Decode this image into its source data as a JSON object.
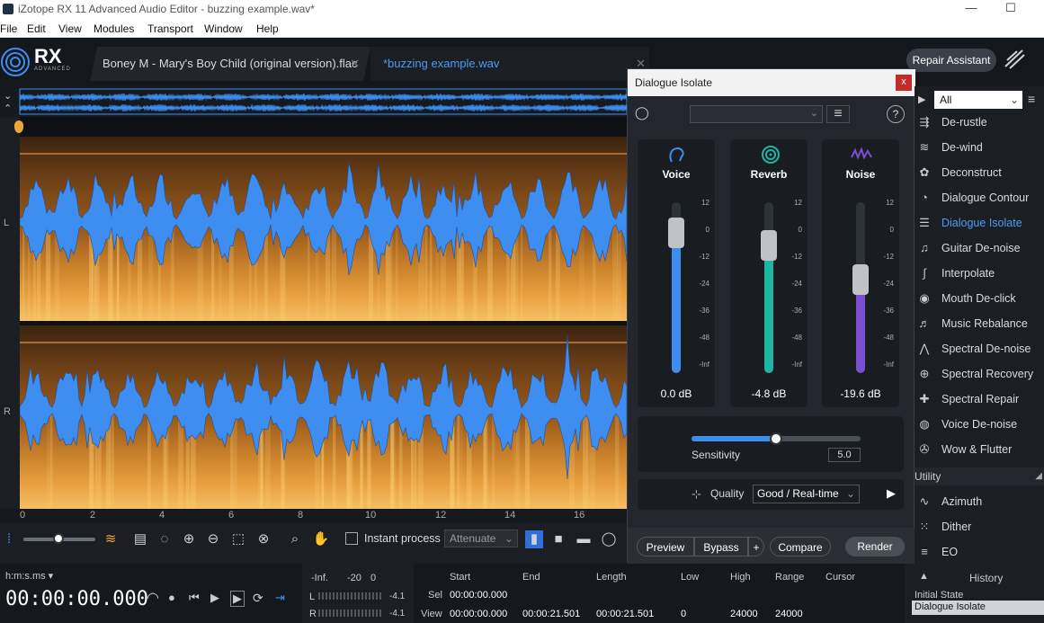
{
  "window": {
    "title": "iZotope RX 11 Advanced Audio Editor - buzzing example.wav*",
    "minimize": "—",
    "maximize": "☐"
  },
  "menu": [
    "File",
    "Edit",
    "View",
    "Modules",
    "Transport",
    "Window",
    "Help"
  ],
  "logo": {
    "rx": "RX",
    "advanced": "ADVANCED"
  },
  "tabs": [
    {
      "label": "Boney M - Mary's Boy Child (original version).flac",
      "close": "✕"
    },
    {
      "label": "*buzzing example.wav",
      "close": "✕"
    }
  ],
  "repair_assistant": "Repair Assistant",
  "channels": {
    "left": "L",
    "right": "R"
  },
  "ruler": [
    "0",
    "2",
    "4",
    "6",
    "8",
    "10",
    "12",
    "14",
    "16"
  ],
  "toolbar": {
    "instant_process": "Instant process",
    "attenuate": "Attenuate"
  },
  "transport": {
    "time_format": "h:m:s.ms",
    "time": "00:00:00.000"
  },
  "meter": {
    "inf": "-Inf.",
    "m20": "-20",
    "zero": "0",
    "l": "L",
    "r": "R",
    "l_peak": "-4.1",
    "r_peak": "-4.1"
  },
  "selection": {
    "start_label": "Start",
    "end_label": "End",
    "length_label": "Length",
    "low_label": "Low",
    "high_label": "High",
    "range_label": "Range",
    "cursor_label": "Cursor",
    "sel_label": "Sel",
    "view_label": "View",
    "sel_start": "00:00:00.000",
    "view_start": "00:00:00.000",
    "view_end": "00:00:21.501",
    "view_length": "00:00:21.501",
    "low": "0",
    "high": "24000",
    "range": "24000"
  },
  "panel": {
    "title": "Dialogue Isolate",
    "close": "x",
    "help": "?",
    "modules": [
      {
        "name": "Voice",
        "value": "0.0 dB",
        "level": 0.82,
        "color": "#3d8ef0"
      },
      {
        "name": "Reverb",
        "value": "-4.8 dB",
        "level": 0.75,
        "color": "#1fb5a3"
      },
      {
        "name": "Noise",
        "value": "-19.6 dB",
        "level": 0.55,
        "color": "#7a4fd0"
      }
    ],
    "scale": [
      "12",
      "0",
      "-12",
      "-24",
      "-36",
      "-48",
      "-Inf"
    ],
    "sensitivity_label": "Sensitivity",
    "sensitivity_value": "5.0",
    "sensitivity_level": 0.5,
    "quality_label": "Quality",
    "quality_value": "Good / Real-time",
    "preview": "Preview",
    "bypass": "Bypass",
    "plus": "+",
    "compare": "Compare",
    "render": "Render"
  },
  "sidebar": {
    "filter": "All",
    "items": [
      {
        "label": "De-rustle",
        "icon": "de-rustle-icon",
        "glyph": "⇶"
      },
      {
        "label": "De-wind",
        "icon": "de-wind-icon",
        "glyph": "≋"
      },
      {
        "label": "Deconstruct",
        "icon": "deconstruct-icon",
        "glyph": "✿"
      },
      {
        "label": "Dialogue Contour",
        "icon": "dialogue-contour-icon",
        "glyph": "◔"
      },
      {
        "label": "Dialogue Isolate",
        "icon": "dialogue-isolate-icon",
        "glyph": "☰"
      },
      {
        "label": "Guitar De-noise",
        "icon": "guitar-icon",
        "glyph": "♫"
      },
      {
        "label": "Interpolate",
        "icon": "interpolate-icon",
        "glyph": "∫"
      },
      {
        "label": "Mouth De-click",
        "icon": "mouth-icon",
        "glyph": "◉"
      },
      {
        "label": "Music Rebalance",
        "icon": "rebalance-icon",
        "glyph": "♬"
      },
      {
        "label": "Spectral De-noise",
        "icon": "spectral-denoise-icon",
        "glyph": "⋀"
      },
      {
        "label": "Spectral Recovery",
        "icon": "spectral-recovery-icon",
        "glyph": "⊕"
      },
      {
        "label": "Spectral Repair",
        "icon": "spectral-repair-icon",
        "glyph": "✚"
      },
      {
        "label": "Voice De-noise",
        "icon": "voice-denoise-icon",
        "glyph": "◍"
      },
      {
        "label": "Wow & Flutter",
        "icon": "wow-flutter-icon",
        "glyph": "✇"
      }
    ],
    "utility_label": "Utility",
    "utility_items": [
      {
        "label": "Azimuth",
        "icon": "azimuth-icon",
        "glyph": "∿"
      },
      {
        "label": "Dither",
        "icon": "dither-icon",
        "glyph": "⁙"
      },
      {
        "label": "EQ",
        "icon": "eq-icon",
        "glyph": "≡"
      }
    ]
  },
  "history": {
    "title": "History",
    "items": [
      "Initial State",
      "Dialogue Isolate"
    ]
  },
  "colors": {
    "accent": "#3d8ef0",
    "wave": "#3d8ef0"
  }
}
